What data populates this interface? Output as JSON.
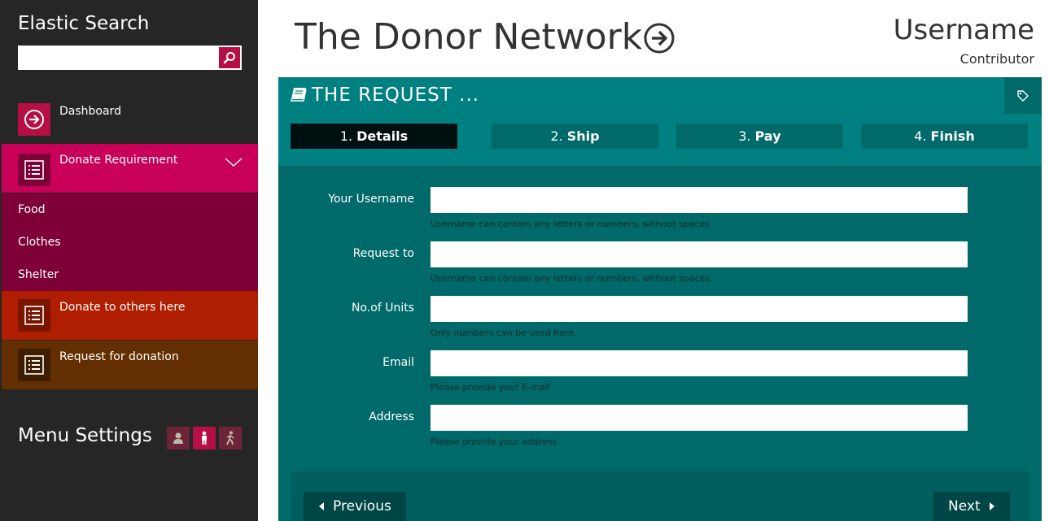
{
  "sidebar": {
    "title": "Elastic Search",
    "search": {
      "placeholder": "",
      "value": ""
    },
    "items": [
      {
        "label": "Dashboard",
        "icon": "arrow-circle-right-icon"
      },
      {
        "label": "Donate Requirement",
        "icon": "list-icon",
        "expanded": true,
        "children": [
          {
            "label": "Food"
          },
          {
            "label": "Clothes"
          },
          {
            "label": "Shelter"
          }
        ]
      },
      {
        "label": "Donate to others here",
        "icon": "list-icon"
      },
      {
        "label": "Request for donation",
        "icon": "list-icon"
      }
    ],
    "menu_settings": {
      "label": "Menu Settings",
      "buttons": [
        "user-icon",
        "person-icon",
        "walking-icon"
      ]
    }
  },
  "header": {
    "brand": "The Donor Network",
    "user": {
      "name": "Username",
      "role": "Contributor"
    }
  },
  "panel": {
    "title": "THE REQUEST ...",
    "steps": [
      {
        "num": "1.",
        "label": "Details",
        "active": true
      },
      {
        "num": "2.",
        "label": "Ship",
        "active": false
      },
      {
        "num": "3.",
        "label": "Pay",
        "active": false
      },
      {
        "num": "4.",
        "label": "Finish",
        "active": false
      }
    ],
    "fields": [
      {
        "label": "Your Username",
        "value": "",
        "hint": "Username can contain any letters or numbers, without spaces"
      },
      {
        "label": "Request to",
        "value": "",
        "hint": "Username can contain any letters or numbers, without spaces"
      },
      {
        "label": "No.of Units",
        "value": "",
        "hint": "Only numbers can be used here."
      },
      {
        "label": "Email",
        "value": "",
        "hint": "Please provide your E-mail"
      },
      {
        "label": "Address",
        "value": "",
        "hint": "Please provide your address"
      }
    ],
    "buttons": {
      "previous": "Previous",
      "next": "Next"
    }
  },
  "colors": {
    "sidebar_bg": "#262626",
    "accent_crimson": "#b50f46",
    "active_nav": "#c8005a",
    "submenu": "#7d0037",
    "nav_orange": "#b01e00",
    "nav_brown": "#632f00",
    "panel_teal": "#006969",
    "panel_head": "#008080"
  }
}
